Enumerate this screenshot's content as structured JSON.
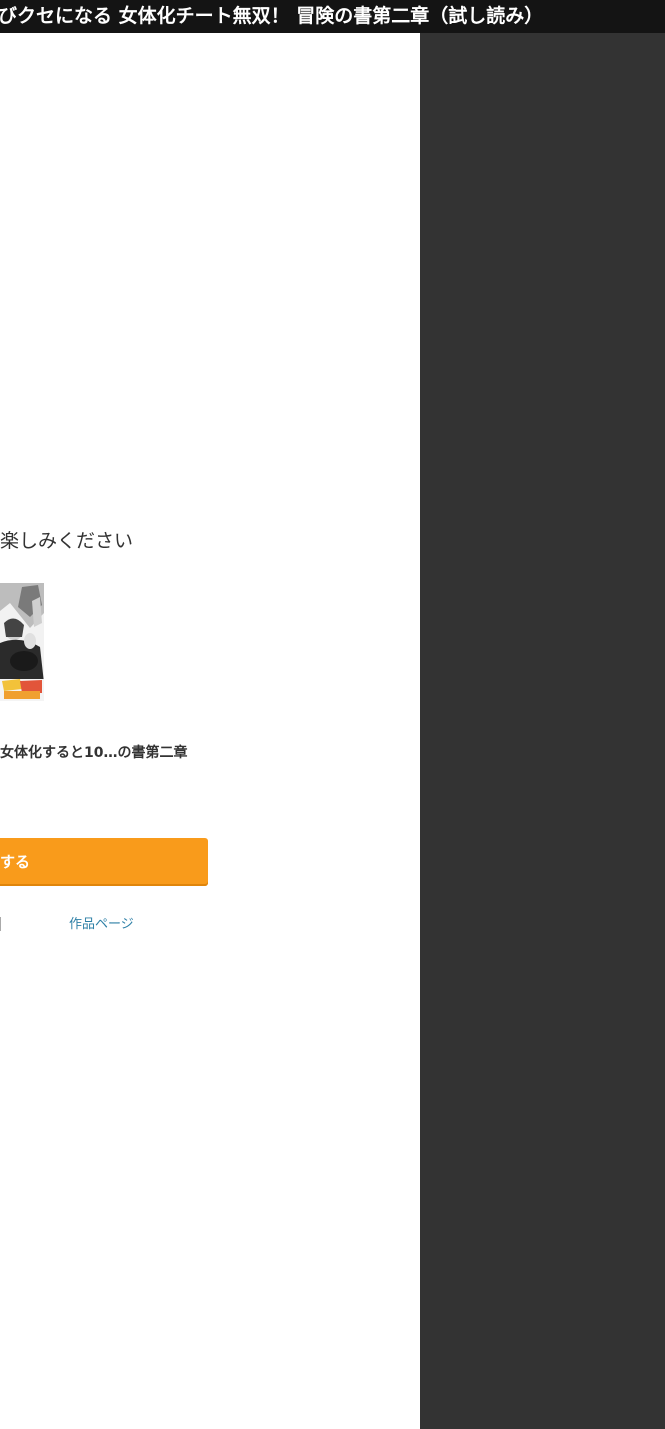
{
  "window": {
    "title": "びクセになる 女体化チート無双！ 冒険の書第二章（試し読み）"
  },
  "main": {
    "message": "楽しみください",
    "work_title": "女体化すると10…の書第二章",
    "cta_label": "する",
    "work_page_link": "作品ページ"
  },
  "colors": {
    "title_bar": "#141414",
    "side_panel": "#333333",
    "cta": "#f99b1b",
    "link": "#2d7fa6"
  },
  "icons": {
    "cover_thumbnail": "manga-cover-image"
  }
}
